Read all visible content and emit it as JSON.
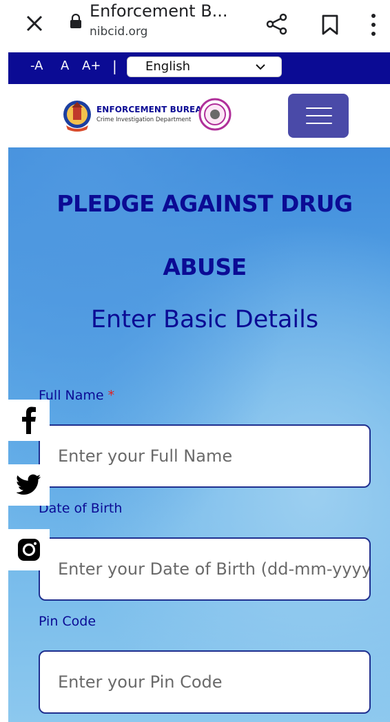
{
  "browser": {
    "title": "Enforcement B...",
    "url": "nibcid.org"
  },
  "accessibility": {
    "decrease": "-A",
    "normal": "A",
    "increase": "A+",
    "separator": "|",
    "language": "English"
  },
  "header": {
    "brand_title": "ENFORCEMENT BUREAU",
    "brand_subtitle": "Crime Investigation Department"
  },
  "page": {
    "pledge_title_line1": "PLEDGE AGAINST DRUG",
    "pledge_title_line2": "ABUSE",
    "subtitle": "Enter Basic Details"
  },
  "form": {
    "full_name_label": "Full Name",
    "required_mark": "*",
    "full_name_placeholder": "Enter your Full Name",
    "dob_label": "Date of Birth",
    "dob_placeholder": "Enter your Date of Birth (dd-mm-yyyy)",
    "pin_label": "Pin Code",
    "pin_placeholder": "Enter your Pin Code"
  },
  "social": [
    "facebook-icon",
    "twitter-icon",
    "instagram-icon"
  ],
  "colors": {
    "navy": "#0b0b94",
    "menu_button": "#4a4aa8",
    "input_border": "#1f2f8f",
    "required": "#e02020"
  }
}
